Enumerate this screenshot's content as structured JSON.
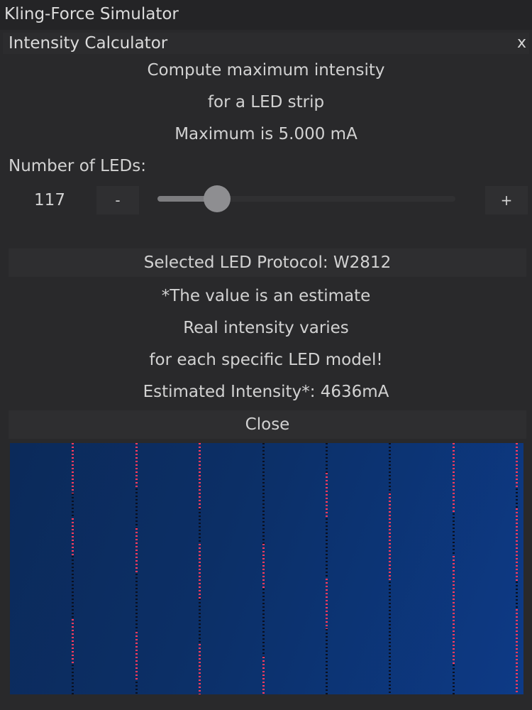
{
  "window": {
    "title": "Kling-Force Simulator"
  },
  "modal": {
    "title": "Intensity Calculator",
    "close_glyph": "x",
    "lines": {
      "l1": "Compute maximum intensity",
      "l2": "for a LED strip",
      "l3": "Maximum is 5.000 mA"
    },
    "leds_label": "Number of LEDs:",
    "leds": {
      "value": "117",
      "minus_label": "-",
      "plus_label": "+",
      "slider_fraction": 0.2
    },
    "protocol_text": "Selected LED Protocol: W2812",
    "notes": {
      "n1": "*The value is an estimate",
      "n2": "Real intensity varies",
      "n3": "for each specific LED model!"
    },
    "estimated": "Estimated Intensity*: 4636mA",
    "close_label": "Close"
  },
  "preview": {
    "strip_count": 8,
    "colors": {
      "red": "#ff3b5c",
      "dark": "#0a0f1f",
      "background": "#0c2f66"
    }
  }
}
